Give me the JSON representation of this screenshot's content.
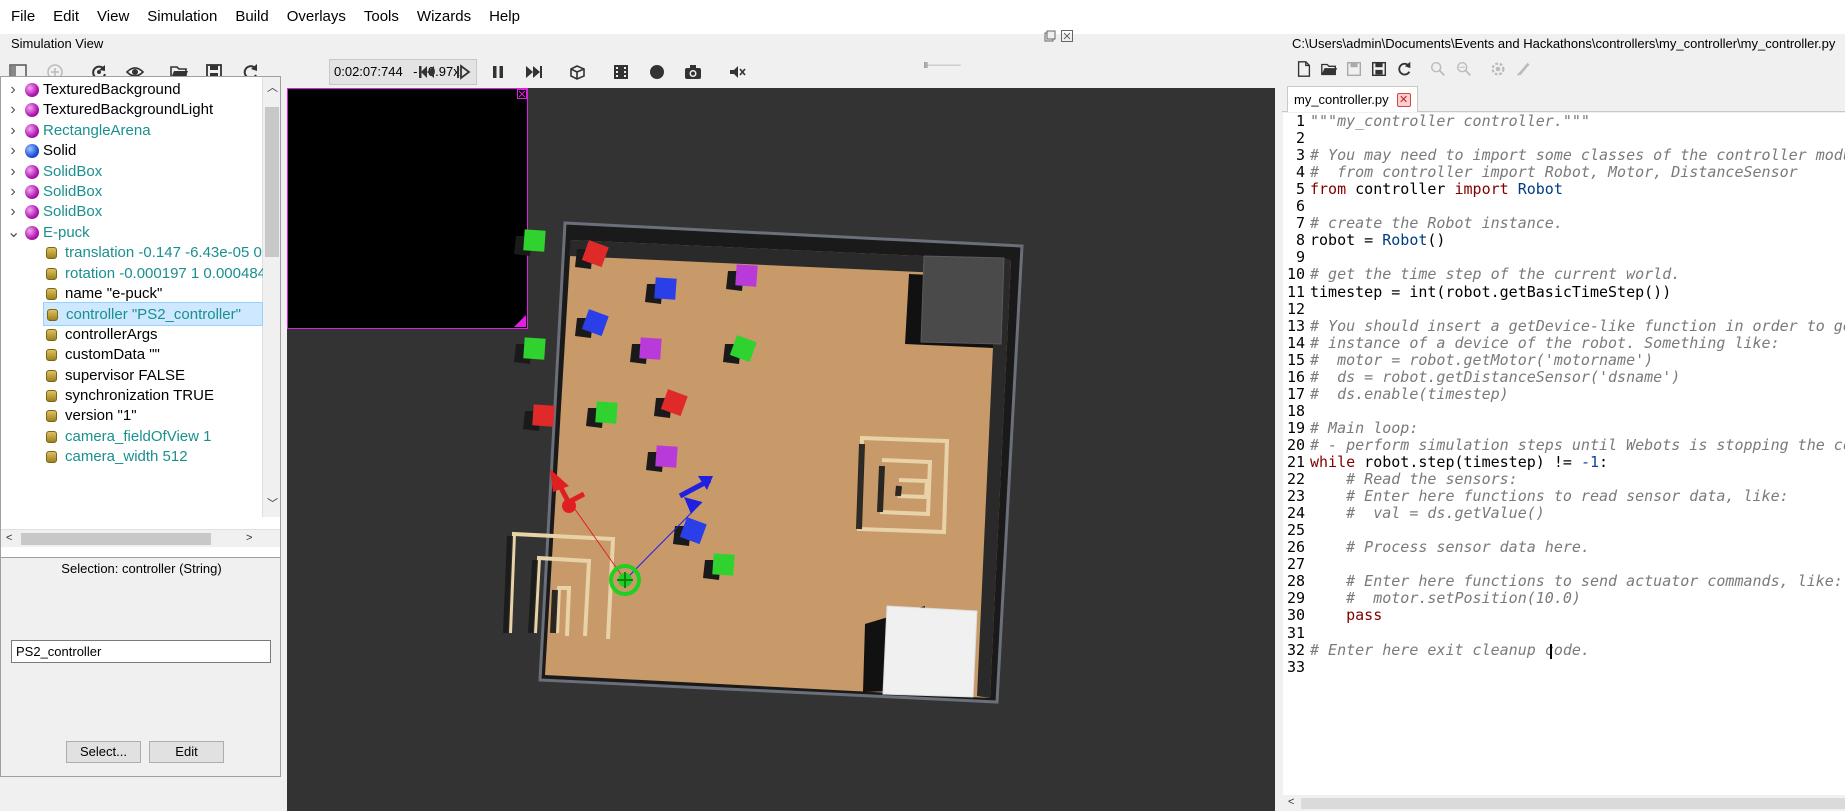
{
  "menubar": {
    "items": [
      "File",
      "Edit",
      "View",
      "Simulation",
      "Build",
      "Overlays",
      "Tools",
      "Wizards",
      "Help"
    ]
  },
  "simulation_view": {
    "title": "Simulation View",
    "time": "0:02:07:744",
    "separator": "-",
    "speed": "0.97x"
  },
  "toolbar_icons": [
    "sidebar-toggle-icon",
    "add-node-icon",
    "reload-world-icon",
    "view-icon",
    "open-world-icon",
    "save-world-icon",
    "reset-icon",
    "step-back-icon",
    "step-icon",
    "pause-icon",
    "fast-forward-icon",
    "cube-icon",
    "video-record-icon",
    "record-icon",
    "camera-screenshot-icon",
    "speaker-mute-icon"
  ],
  "scene_tree": {
    "nodes": [
      {
        "label": "TexturedBackground",
        "ball": "purple",
        "color": "#000000"
      },
      {
        "label": "TexturedBackgroundLight",
        "ball": "purple",
        "color": "#000000"
      },
      {
        "label": "RectangleArena",
        "ball": "purple",
        "color": "#1b8f8f"
      },
      {
        "label": "Solid",
        "ball": "blue",
        "color": "#000000"
      },
      {
        "label": "SolidBox",
        "ball": "purple",
        "color": "#1b8f8f"
      },
      {
        "label": "SolidBox",
        "ball": "purple",
        "color": "#1b8f8f"
      },
      {
        "label": "SolidBox",
        "ball": "purple",
        "color": "#1b8f8f"
      },
      {
        "label": "E-puck",
        "ball": "purple",
        "color": "#1b8f8f",
        "expanded": true
      }
    ],
    "fields": [
      {
        "label": "translation -0.147 -6.43e-05 0",
        "color": "#1b8f8f"
      },
      {
        "label": "rotation -0.000197 1 0.000484",
        "color": "#1b8f8f"
      },
      {
        "label": "name \"e-puck\"",
        "color": "#000000"
      },
      {
        "label": "controller \"PS2_controller\"",
        "color": "#1b8f8f",
        "selected": true
      },
      {
        "label": "controllerArgs",
        "color": "#000000"
      },
      {
        "label": "customData \"\"",
        "color": "#000000"
      },
      {
        "label": "supervisor FALSE",
        "color": "#000000"
      },
      {
        "label": "synchronization TRUE",
        "color": "#000000"
      },
      {
        "label": "version \"1\"",
        "color": "#000000"
      },
      {
        "label": "camera_fieldOfView 1",
        "color": "#1b8f8f"
      },
      {
        "label": "camera_width 512",
        "color": "#1b8f8f"
      }
    ]
  },
  "field_editor": {
    "selection_label": "Selection: controller (String)",
    "value": "PS2_controller",
    "select_button": "Select...",
    "edit_button": "Edit"
  },
  "editor": {
    "path": "C:\\Users\\admin\\Documents\\Events and Hackathons\\controllers\\my_controller\\my_controller.py",
    "tab_label": "my_controller.py",
    "tab_close": "✕",
    "line_numbers": [
      "1",
      "2",
      "3",
      "4",
      "5",
      "6",
      "7",
      "8",
      "9",
      "10",
      "11",
      "12",
      "13",
      "14",
      "15",
      "16",
      "17",
      "18",
      "19",
      "20",
      "21",
      "22",
      "23",
      "24",
      "25",
      "26",
      "27",
      "28",
      "29",
      "30",
      "31",
      "32",
      "33"
    ],
    "lines": [
      "\"\"\"my_controller controller.\"\"\"",
      "",
      "# You may need to import some classes of the controller module. Ex:",
      "#  from controller import Robot, Motor, DistanceSensor",
      "from controller import Robot",
      "",
      "# create the Robot instance.",
      "robot = Robot()",
      "",
      "# get the time step of the current world.",
      "timestep = int(robot.getBasicTimeStep())",
      "",
      "# You should insert a getDevice-like function in order to get the",
      "# instance of a device of the robot. Something like:",
      "#  motor = robot.getMotor('motorname')",
      "#  ds = robot.getDistanceSensor('dsname')",
      "#  ds.enable(timestep)",
      "",
      "# Main loop:",
      "# - perform simulation steps until Webots is stopping the controller",
      "while robot.step(timestep) != -1:",
      "    # Read the sensors:",
      "    # Enter here functions to read sensor data, like:",
      "    #  val = ds.getValue()",
      "",
      "    # Process sensor data here.",
      "",
      "    # Enter here functions to send actuator commands, like:",
      "    #  motor.setPosition(10.0)",
      "    pass",
      "",
      "# Enter here exit cleanup code.",
      ""
    ]
  },
  "arena": {
    "boxes": [
      {
        "color": "#2fd22f"
      },
      {
        "color": "#e02a2a"
      },
      {
        "color": "#2a3fe8"
      },
      {
        "color": "#b83ad8"
      },
      {
        "color": "#2a3fe8"
      },
      {
        "color": "#2fd22f"
      },
      {
        "color": "#b83ad8"
      },
      {
        "color": "#2fd22f"
      },
      {
        "color": "#e02a2a"
      },
      {
        "color": "#2fd22f"
      },
      {
        "color": "#e02a2a"
      },
      {
        "color": "#b83ad8"
      },
      {
        "color": "#2fd22f"
      },
      {
        "color": "#2a3fe8"
      }
    ],
    "floor_color": "#c89a6a",
    "wall_color": "#e8d2a8"
  }
}
